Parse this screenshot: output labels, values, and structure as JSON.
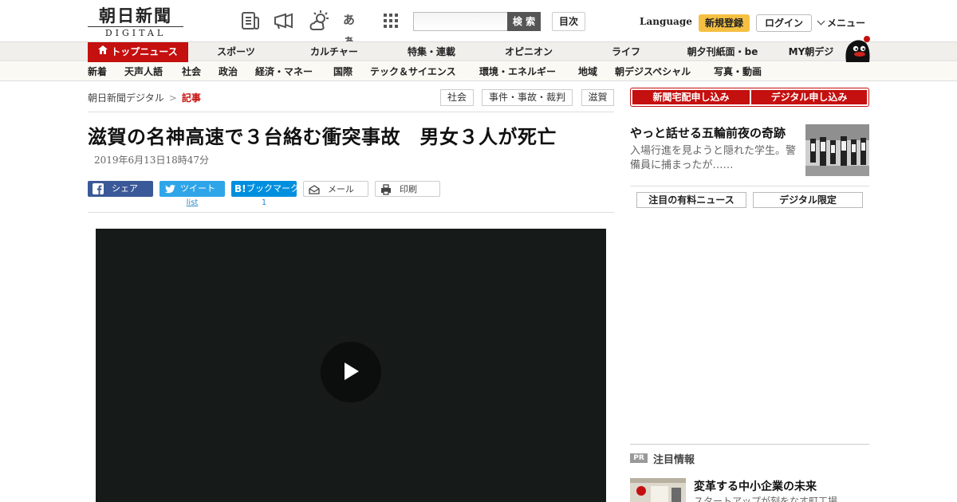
{
  "header": {
    "logo_jp": "朝日新聞",
    "logo_en": "DIGITAL",
    "icons": [
      "newspaper-icon",
      "megaphone-icon",
      "weather-icon",
      "font-size-icon",
      "app-grid-icon"
    ],
    "font_icon_label": "あぁ",
    "search_placeholder": "",
    "search_label": "検 索",
    "toc_label": "目次",
    "language_label": "Language",
    "signup_label": "新規登録",
    "login_label": "ログイン",
    "menu_label": "メニュー"
  },
  "mainnav": {
    "items": [
      "トップニュース",
      "スポーツ",
      "カルチャー",
      "特集・連載",
      "オピニオン",
      "ライフ",
      "朝夕刊紙面・be",
      "MY朝デジ"
    ]
  },
  "subnav": {
    "items": [
      "新着",
      "天声人語",
      "社会",
      "政治",
      "経済・マネー",
      "国際",
      "テック＆サイエンス",
      "環境・エネルギー",
      "地域",
      "朝デジスペシャル",
      "写真・動画"
    ]
  },
  "breadcrumb": {
    "home": "朝日新聞デジタル",
    "separator": ">",
    "current": "記事"
  },
  "tags": [
    "社会",
    "事件・事故・裁判",
    "滋賀"
  ],
  "article": {
    "title": "滋賀の名神高速で３台絡む衝突事故　男女３人が死亡",
    "date": "2019年6月13日18時47分"
  },
  "share": {
    "facebook": "シェア",
    "twitter": "ツイート",
    "hatena": "ブックマーク",
    "mail": "メール",
    "print": "印刷",
    "twitter_count": "list",
    "hatena_count": "1"
  },
  "sidebar": {
    "subscribe_paper": "新聞宅配申し込み",
    "subscribe_digital": "デジタル申し込み",
    "featured_title": "やっと話せる五輪前夜の奇跡",
    "featured_desc": "入場行進を見ようと隠れた学生。警備員に捕まったが……",
    "tab_paid_news": "注目の有料ニュース",
    "tab_digital_only": "デジタル限定",
    "pr_badge": "PR",
    "pr_section_title": "注目情報",
    "pr_headline": "変革する中小企業の未来",
    "pr_sub": "スタートアップが刻をなす町工場"
  },
  "colors": {
    "brand_red": "#c4100f",
    "signup_yellow": "#f5c042",
    "facebook_blue": "#3b5998",
    "twitter_blue": "#2fa5e9",
    "hatena_blue": "#008fde",
    "video_bg": "#161a18"
  }
}
